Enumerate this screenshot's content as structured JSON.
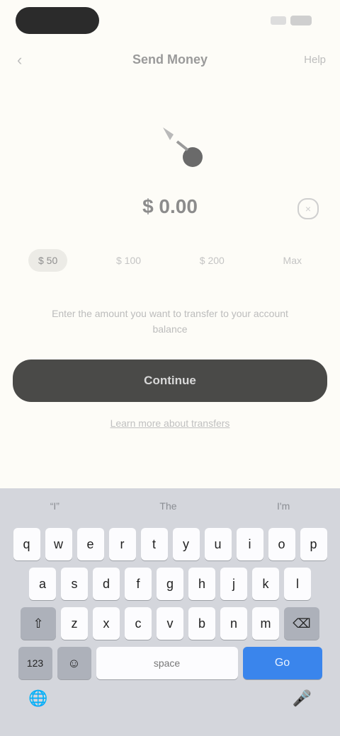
{
  "status": {
    "time": ""
  },
  "nav": {
    "back_glyph": "‹",
    "title": "Send Money",
    "right": "Help"
  },
  "amount": {
    "value": "$ 0.00",
    "clear_glyph": "×"
  },
  "chips": [
    "$ 50",
    "$ 100",
    "$ 200",
    "Max"
  ],
  "note": "Enter the amount you want to transfer to your account balance",
  "primary_button": "Continue",
  "secondary_link": "Learn more about transfers",
  "keyboard": {
    "suggestions": [
      "“I”",
      "The",
      "I'm"
    ],
    "rows": [
      [
        "q",
        "w",
        "e",
        "r",
        "t",
        "y",
        "u",
        "i",
        "o",
        "p"
      ],
      [
        "a",
        "s",
        "d",
        "f",
        "g",
        "h",
        "j",
        "k",
        "l"
      ],
      [
        "z",
        "x",
        "c",
        "v",
        "b",
        "n",
        "m"
      ]
    ],
    "shift_glyph": "⇧",
    "delete_glyph": "⌫",
    "num_label": "123",
    "emoji_glyph": "☺",
    "space_label": "space",
    "go_label": "Go",
    "globe_glyph": "🌐",
    "mic_glyph": "🎤"
  },
  "colors": {
    "primary": "#4a4a48",
    "accent": "#3a85ec",
    "background": "#fdfcf7"
  }
}
